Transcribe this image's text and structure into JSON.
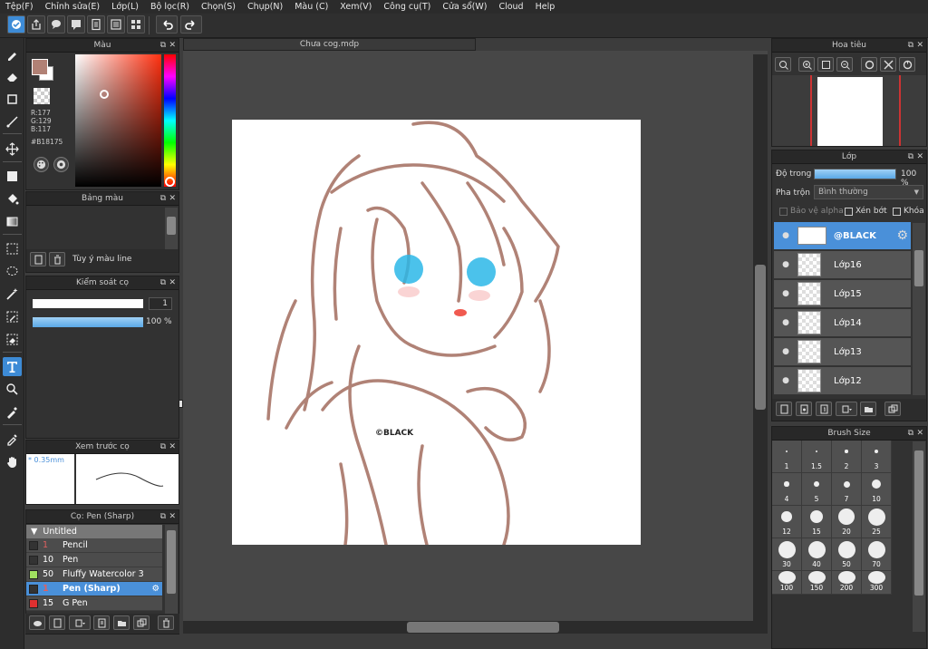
{
  "menu": [
    "Tệp(F)",
    "Chỉnh sửa(E)",
    "Lớp(L)",
    "Bộ lọc(R)",
    "Chọn(S)",
    "Chụp(N)",
    "Màu (C)",
    "Xem(V)",
    "Công cụ(T)",
    "Cửa sổ(W)",
    "Cloud",
    "Help"
  ],
  "document": {
    "tab_title": "Chưa cog.mdp",
    "watermark": "©BLACK"
  },
  "color_panel": {
    "title": "Màu",
    "r": "R:177",
    "g": "G:129",
    "b": "B:117",
    "hex": "#B18175",
    "fg_color": "#B18175"
  },
  "palette_panel": {
    "title": "Bảng màu",
    "swatches": [
      "#5a3a2a",
      "#a04a3a",
      "#d04040",
      "#3050c0",
      "#2060d0",
      "#f0c0a0",
      "#e0b090",
      "#b06050",
      "#f0b0a0",
      "#c0c0c0",
      "#909090",
      "#c0d8f0",
      "#e0e0e0",
      "#c8a880",
      "#f0d0c0"
    ],
    "custom_label": "Tùy ý màu line"
  },
  "brush_control": {
    "title": "Kiểm soát cọ",
    "size_value": "1",
    "opacity_value": "100 %"
  },
  "brush_preview": {
    "title": "Xem trước cọ",
    "size_label": "* 0.35mm"
  },
  "brush_list": {
    "title": "Cọ: Pen (Sharp)",
    "group": "Untitled",
    "items": [
      {
        "size": "1",
        "name": "Pencil",
        "color": "#333333",
        "size_color": "#e06060"
      },
      {
        "size": "10",
        "name": "Pen",
        "color": "#333333",
        "size_color": "#ffffff"
      },
      {
        "size": "50",
        "name": "Fluffy Watercolor 3",
        "color": "#a0e060",
        "size_color": "#ffffff"
      },
      {
        "size": "1",
        "name": "Pen (Sharp)",
        "color": "#333333",
        "size_color": "#e06060"
      },
      {
        "size": "15",
        "name": "G Pen",
        "color": "#e03030",
        "size_color": "#ffffff"
      }
    ]
  },
  "navigator": {
    "title": "Hoa tiêu"
  },
  "layers": {
    "title": "Lớp",
    "opacity_label": "Độ trong",
    "opacity_value": "100 %",
    "opacity": 100,
    "blend_label": "Pha trộn",
    "blend_value": "Bình thường",
    "protect_alpha": "Bảo vệ alpha",
    "clipping": "Xén bớt",
    "lock": "Khóa",
    "items": [
      "@BLACK",
      "Lớp16",
      "Lớp15",
      "Lớp14",
      "Lớp13",
      "Lớp12"
    ]
  },
  "brush_size": {
    "title": "Brush Size",
    "sizes": [
      "1",
      "1.5",
      "2",
      "3",
      "4",
      "5",
      "7",
      "10",
      "12",
      "15",
      "20",
      "25",
      "30",
      "40",
      "50",
      "70",
      "100",
      "150",
      "200",
      "300"
    ]
  }
}
